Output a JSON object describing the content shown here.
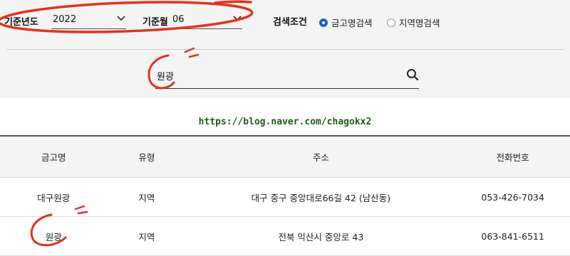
{
  "filter": {
    "year": {
      "label": "기준년도",
      "value": "2022"
    },
    "month": {
      "label": "기준월",
      "value": "06"
    },
    "condition": {
      "label": "검색조건",
      "options": [
        {
          "label": "금고명검색",
          "selected": true
        },
        {
          "label": "지역명검색",
          "selected": false
        }
      ]
    }
  },
  "search": {
    "value": "원광",
    "icon": "search-icon"
  },
  "watermark": "https://blog.naver.com/chagokx2",
  "table": {
    "headers": [
      "금고명",
      "유형",
      "주소",
      "전화번호"
    ],
    "rows": [
      [
        "대구원광",
        "지역",
        "대구 중구 중앙대로66길 42 (남산동)",
        "053-426-7034"
      ],
      [
        "원광",
        "지역",
        "전북 익산시 중앙로 43",
        "063-841-6511"
      ]
    ]
  },
  "colors": {
    "accent": "#1e63c4",
    "annotation": "#e4321b",
    "panel": "#f4f4f4",
    "watermark": "#1f5a1b"
  }
}
